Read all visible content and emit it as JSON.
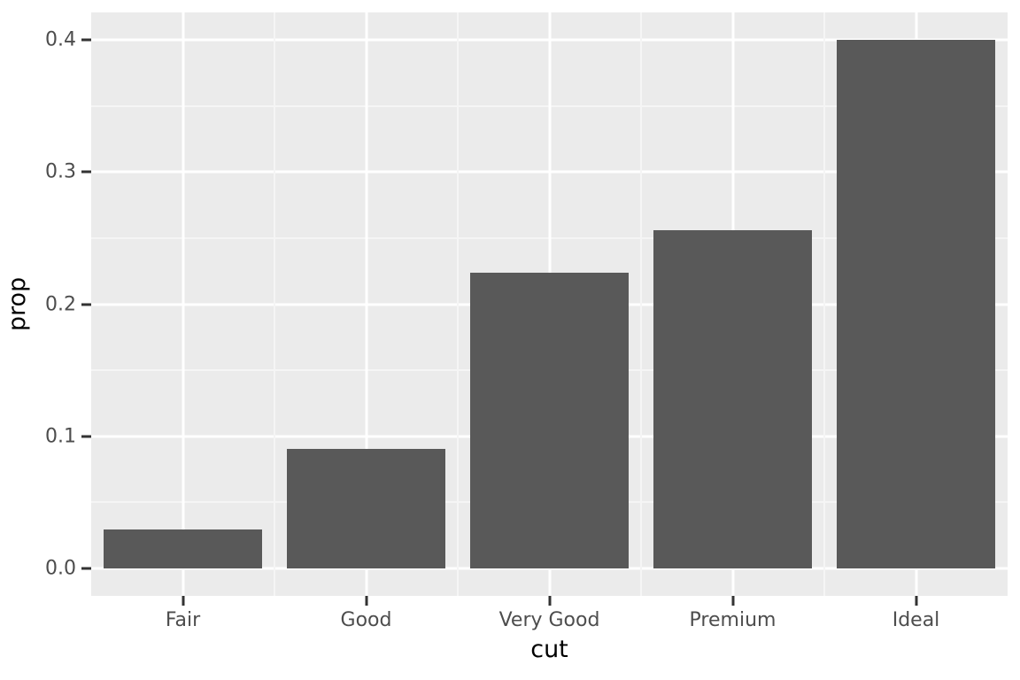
{
  "chart_data": {
    "type": "bar",
    "title": "",
    "subtitle": "",
    "xlabel": "cut",
    "ylabel": "prop",
    "categories": [
      "Fair",
      "Good",
      "Very Good",
      "Premium",
      "Ideal"
    ],
    "values": [
      0.0298,
      0.0905,
      0.2238,
      0.2559,
      0.3998
    ],
    "series": [
      {
        "name": "prop",
        "values": [
          0.0298,
          0.0905,
          0.2238,
          0.2559,
          0.3998
        ]
      }
    ],
    "ylim": [
      -0.0094,
      0.4185
    ],
    "y_ticks": [
      0.0,
      0.1,
      0.2,
      0.3,
      0.4
    ],
    "y_tick_labels": [
      "0.0",
      "0.1",
      "0.2",
      "0.3",
      "0.4"
    ],
    "y_minor_ticks": [
      0.05,
      0.15,
      0.25,
      0.35
    ],
    "x_tick_labels": [
      "Fair",
      "Good",
      "Very Good",
      "Premium",
      "Ideal"
    ],
    "grid": true,
    "legend": "none",
    "legend_position": "none",
    "bar_color": "#595959",
    "panel_background": "#EBEBEB",
    "grid_major_color": "#FFFFFF",
    "grid_minor_color": "#F5F5F5",
    "axis_text_color": "#4D4D4D",
    "axis_title_color": "#000000",
    "plot_background": "#FFFFFF"
  }
}
